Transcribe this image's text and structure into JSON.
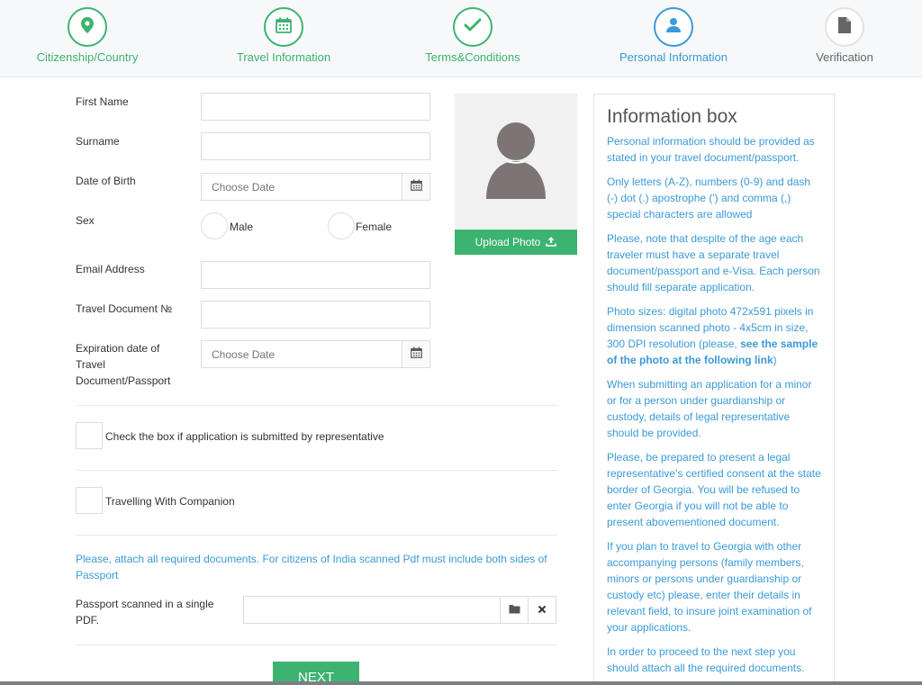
{
  "steps": [
    {
      "label": "Citizenship/Country",
      "icon": "map-pin-icon"
    },
    {
      "label": "Travel Information",
      "icon": "calendar-icon"
    },
    {
      "label": "Terms&Conditions",
      "icon": "checkmark-icon"
    },
    {
      "label": "Personal Information",
      "icon": "user-icon"
    },
    {
      "label": "Verification",
      "icon": "document-icon"
    }
  ],
  "colors": {
    "green": "#3cb371",
    "blue": "#3a9ad9"
  },
  "form": {
    "first_name_label": "First Name",
    "first_name_value": "",
    "surname_label": "Surname",
    "surname_value": "",
    "dob_label": "Date of Birth",
    "dob_placeholder": "Choose Date",
    "sex_label": "Sex",
    "sex_options": [
      "Male",
      "Female"
    ],
    "email_label": "Email Address",
    "email_value": "",
    "travel_doc_label": "Travel Document №",
    "travel_doc_value": "",
    "expiration_label": "Expiration date of Travel Document/Passport",
    "expiration_placeholder": "Choose Date",
    "representative_checkbox_label": "Check the box if application is submitted by representative",
    "companion_checkbox_label": "Travelling With Companion",
    "attach_notice": "Please, attach all required documents. For citizens of India scanned Pdf must include both sides of Passport",
    "passport_pdf_label": "Passport scanned in a single PDF.",
    "next_button": "NEXT"
  },
  "photo": {
    "upload_button": "Upload Photo"
  },
  "info_box": {
    "title": "Information box",
    "paragraphs": [
      "Personal information should be provided as stated in your travel document/passport.",
      "Only letters (A-Z), numbers (0-9) and dash (-) dot (.) apostrophe (') and comma (,) special characters are allowed",
      "Please, note that despite of the age each traveler must have a separate travel document/passport and e-Visa. Each person should fill separate application.",
      "When submitting an application for a minor or for a person under guardianship or custody, details of legal representative should be provided.",
      "Please, be prepared to present a legal representative's certified consent at the state border of Georgia. You will be refused to enter Georgia if you will not be able to present abovementioned document.",
      "If you plan to travel to Georgia with other accompanying persons (family members, minors or persons under guardianship or custody etc) please, enter their details in relevant field, to insure joint examination of your applications.",
      "In order to proceed to the next step you should attach all the required documents."
    ],
    "photo_sizes_text": "Photo sizes: digital photo 472x591 pixels in dimension scanned photo - 4x5cm in size, 300 DPI resolution (please,",
    "photo_sizes_link": "see the sample of the photo at the following link",
    "photo_sizes_end": ")"
  }
}
